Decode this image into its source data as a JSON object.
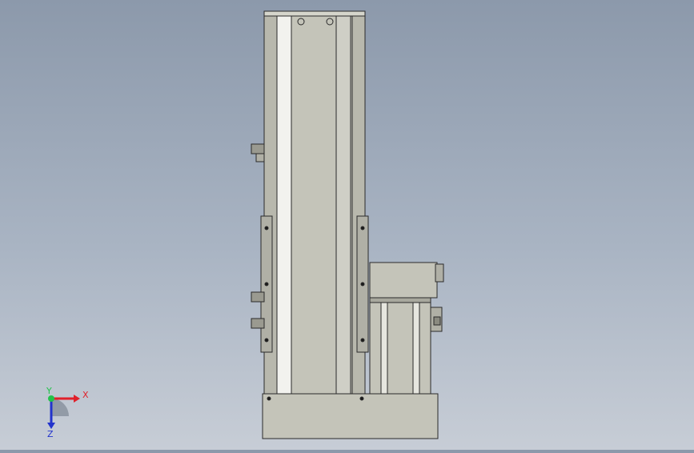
{
  "viewport": {
    "background_top": "#8c99ab",
    "background_bottom": "#c7cdd6"
  },
  "model": {
    "name": "linear-actuator-with-servo-motor",
    "body_color": "#c4c4b9",
    "outline_color": "#2a2a2a",
    "highlight_color": "#f2f2ee"
  },
  "triad": {
    "x_label": "X",
    "y_label": "Y",
    "z_label": "Z",
    "x_color": "#e0202a",
    "y_color": "#22c24a",
    "z_color": "#2233cc"
  }
}
